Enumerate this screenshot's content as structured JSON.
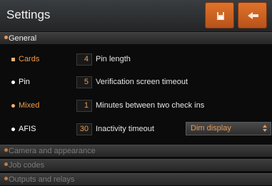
{
  "header": {
    "title": "Settings",
    "save_icon": "save-icon",
    "back_icon": "back-arrow-icon",
    "accent": "#e0732a"
  },
  "sections": [
    {
      "label": "General",
      "expanded": true
    },
    {
      "label": "Camera and appearance",
      "expanded": false
    },
    {
      "label": "Job codes",
      "expanded": false
    },
    {
      "label": "Outputs and relays",
      "expanded": false
    }
  ],
  "general": {
    "rows": [
      {
        "mode": "Cards",
        "value": "4",
        "description": "Pin length"
      },
      {
        "mode": "Pin",
        "value": "5",
        "description": "Verification screen timeout"
      },
      {
        "mode": "Mixed",
        "value": "1",
        "description": "Minutes between two check ins"
      },
      {
        "mode": "AFIS",
        "value": "30",
        "description": "Inactivity timeout"
      }
    ],
    "inactivity_action": "Dim display"
  }
}
